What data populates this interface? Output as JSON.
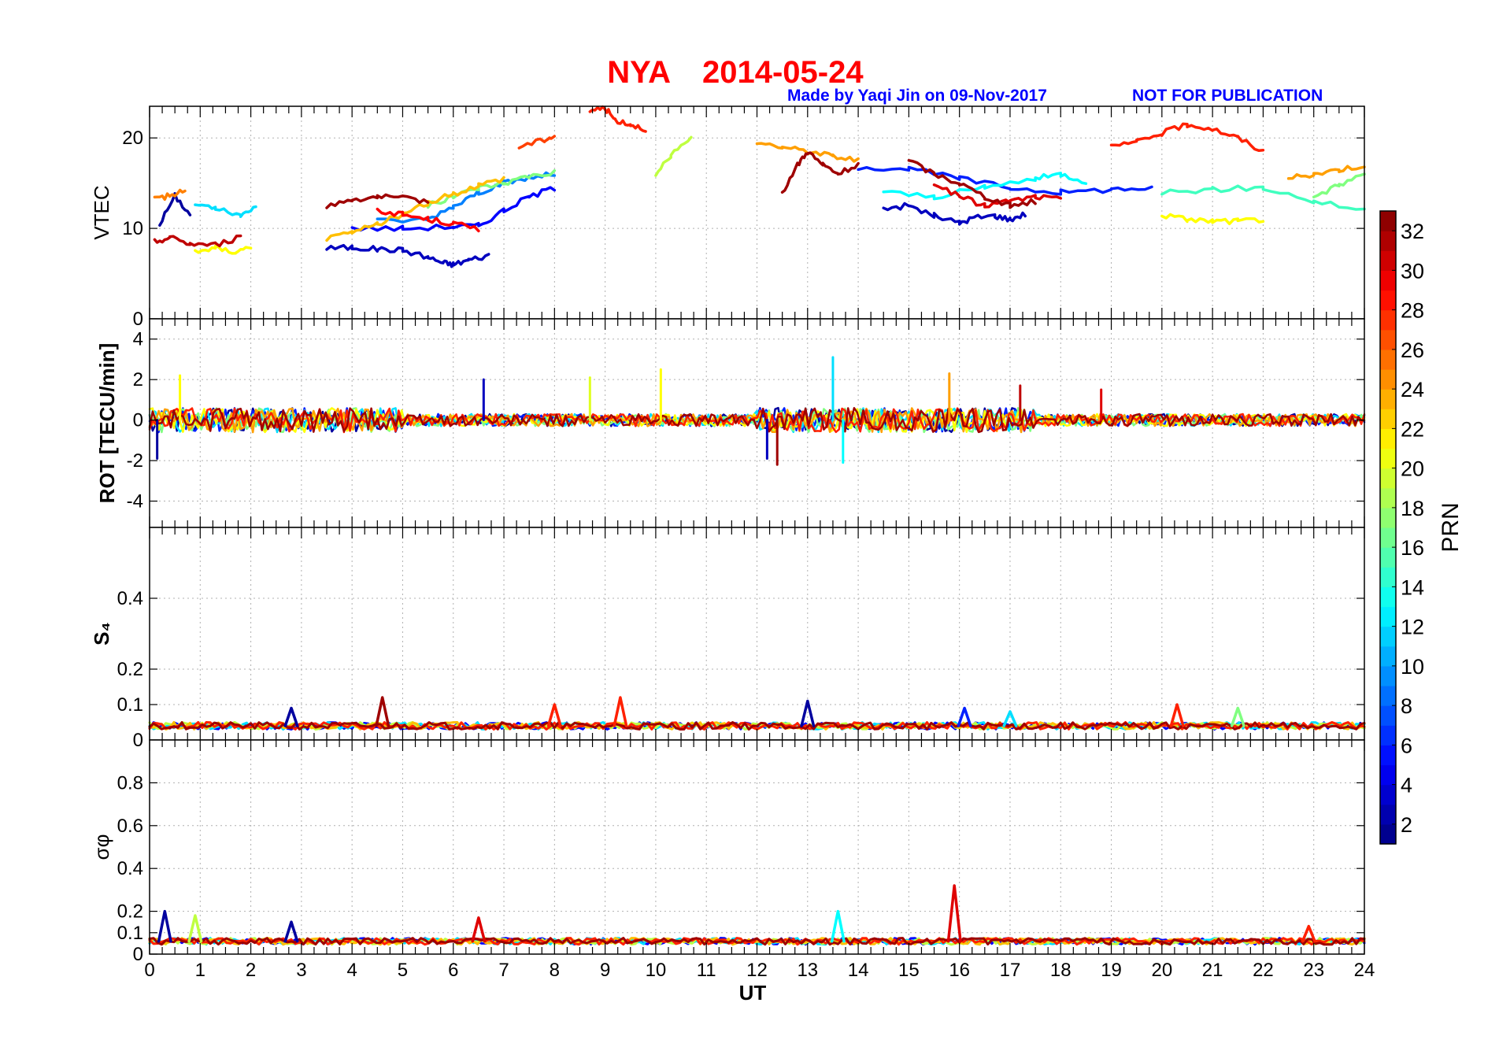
{
  "title": {
    "station": "NYA",
    "date": "2014-05-24",
    "credit": "Made by Yaqi Jin on 09-Nov-2017",
    "notice": "NOT FOR PUBLICATION",
    "title_color": "#ff0000",
    "credit_color": "#0000ff"
  },
  "chart_data": {
    "type": "line",
    "x": {
      "label": "UT",
      "range": [
        0,
        24
      ],
      "ticks": [
        0,
        1,
        2,
        3,
        4,
        5,
        6,
        7,
        8,
        9,
        10,
        11,
        12,
        13,
        14,
        15,
        16,
        17,
        18,
        19,
        20,
        21,
        22,
        23,
        24
      ]
    },
    "grid": true,
    "colormap": "jet",
    "colorbar": {
      "label": "PRN",
      "range": [
        1,
        33
      ],
      "ticks": [
        2,
        4,
        6,
        8,
        10,
        12,
        14,
        16,
        18,
        20,
        22,
        24,
        26,
        28,
        30,
        32
      ],
      "placement": "right"
    },
    "panels": [
      {
        "id": "vtec",
        "ylabel": "VTEC",
        "yrange": [
          0,
          23.5
        ],
        "yticks": [
          0,
          10,
          20
        ],
        "series": [
          {
            "prn": 2,
            "x": [
              0.2,
              0.5,
              0.8
            ],
            "y": [
              10.5,
              13.6,
              11.5
            ]
          },
          {
            "prn": 3,
            "x": [
              3.5,
              4.0,
              4.5,
              5.0,
              5.5,
              5.8,
              6.0,
              6.3,
              6.7
            ],
            "y": [
              7.8,
              7.9,
              7.7,
              7.6,
              6.8,
              6.2,
              6.0,
              6.5,
              7.0
            ]
          },
          {
            "prn": 3,
            "x": [
              14.5,
              15.0,
              15.5,
              16.0,
              16.3,
              16.7,
              17.0,
              17.3
            ],
            "y": [
              12.2,
              12.5,
              11.4,
              10.6,
              11.2,
              11.4,
              11.0,
              11.6
            ]
          },
          {
            "prn": 5,
            "x": [
              4.0,
              5.0,
              6.0,
              6.5,
              7.0,
              7.5,
              8.0
            ],
            "y": [
              10.0,
              10.0,
              10.2,
              10.3,
              12.0,
              13.5,
              14.5
            ]
          },
          {
            "prn": 6,
            "x": [
              14.0,
              15.0,
              16.0,
              17.0,
              18.0,
              19.0,
              19.8
            ],
            "y": [
              16.8,
              16.6,
              15.5,
              14.5,
              14.0,
              14.3,
              14.5
            ]
          },
          {
            "prn": 9,
            "x": [
              4.5,
              5.5,
              6.0,
              6.5,
              7.0,
              7.5,
              8.0
            ],
            "y": [
              10.8,
              11.0,
              12.5,
              14.0,
              15.0,
              15.6,
              16.0
            ]
          },
          {
            "prn": 12,
            "x": [
              0.9,
              1.3,
              1.8,
              2.1
            ],
            "y": [
              12.5,
              12.2,
              11.3,
              12.5
            ]
          },
          {
            "prn": 13,
            "x": [
              14.5,
              15.5,
              16.5,
              17.5,
              18.0,
              18.5
            ],
            "y": [
              14.0,
              13.5,
              14.5,
              15.5,
              16.0,
              15.2
            ]
          },
          {
            "prn": 15,
            "x": [
              20.0,
              21.0,
              22.0,
              23.0,
              24.0
            ],
            "y": [
              14.0,
              14.3,
              14.5,
              13.0,
              12.0
            ]
          },
          {
            "prn": 17,
            "x": [
              5.5,
              6.0,
              6.5,
              7.0,
              7.5,
              8.0
            ],
            "y": [
              12.5,
              13.5,
              14.5,
              15.0,
              15.8,
              16.2
            ]
          },
          {
            "prn": 17,
            "x": [
              23.0,
              23.5,
              24.0
            ],
            "y": [
              13.5,
              14.8,
              16.0
            ]
          },
          {
            "prn": 19,
            "x": [
              10.0,
              10.3,
              10.7
            ],
            "y": [
              16.0,
              18.0,
              20.0
            ]
          },
          {
            "prn": 21,
            "x": [
              0.9,
              1.3,
              1.7,
              2.0
            ],
            "y": [
              7.5,
              7.8,
              7.4,
              8.0
            ]
          },
          {
            "prn": 21,
            "x": [
              20.0,
              20.5,
              21.0,
              21.5,
              22.0
            ],
            "y": [
              11.5,
              11.0,
              10.8,
              10.8,
              11.0
            ]
          },
          {
            "prn": 23,
            "x": [
              3.5,
              4.0,
              4.5,
              5.0,
              5.5,
              6.0,
              6.5,
              7.0
            ],
            "y": [
              8.8,
              9.5,
              10.5,
              11.5,
              12.8,
              13.8,
              14.8,
              15.5
            ]
          },
          {
            "prn": 24,
            "x": [
              12.0,
              12.5,
              13.0,
              13.5,
              14.0
            ],
            "y": [
              19.5,
              19.0,
              18.5,
              18.0,
              17.5
            ]
          },
          {
            "prn": 24,
            "x": [
              22.5,
              23.0,
              23.5,
              24.0
            ],
            "y": [
              15.5,
              16.0,
              16.5,
              17.0
            ]
          },
          {
            "prn": 25,
            "x": [
              0.1,
              0.4,
              0.7
            ],
            "y": [
              13.3,
              13.6,
              14.2
            ]
          },
          {
            "prn": 27,
            "x": [
              7.3,
              7.8,
              8.0
            ],
            "y": [
              19.0,
              19.8,
              20.2
            ]
          },
          {
            "prn": 28,
            "x": [
              8.7,
              9.0,
              9.2,
              9.5,
              9.8
            ],
            "y": [
              23.0,
              23.3,
              22.0,
              21.5,
              21.0
            ]
          },
          {
            "prn": 28,
            "x": [
              19.0,
              19.5,
              20.0,
              20.5,
              21.0,
              21.5,
              22.0
            ],
            "y": [
              19.0,
              19.5,
              20.5,
              21.5,
              21.0,
              20.0,
              18.5
            ]
          },
          {
            "prn": 29,
            "x": [
              4.5,
              5.0,
              5.5,
              6.0,
              6.5
            ],
            "y": [
              12.0,
              11.5,
              11.0,
              10.5,
              10.0
            ]
          },
          {
            "prn": 30,
            "x": [
              15.5,
              16.0,
              16.5,
              17.0,
              17.5,
              18.0
            ],
            "y": [
              15.0,
              13.5,
              12.5,
              13.0,
              13.5,
              13.2
            ]
          },
          {
            "prn": 31,
            "x": [
              0.1,
              0.4,
              0.8,
              1.3,
              1.8
            ],
            "y": [
              8.5,
              9.0,
              8.3,
              8.2,
              9.0
            ]
          },
          {
            "prn": 32,
            "x": [
              3.5,
              4.0,
              4.5,
              5.0,
              5.5
            ],
            "y": [
              12.5,
              13.2,
              13.5,
              13.3,
              13.0
            ]
          },
          {
            "prn": 32,
            "x": [
              12.5,
              12.8,
              13.0,
              13.3,
              13.6,
              14.0
            ],
            "y": [
              14.0,
              17.0,
              18.5,
              17.0,
              16.0,
              17.0
            ]
          },
          {
            "prn": 32,
            "x": [
              15.0,
              15.5,
              16.0,
              16.5,
              17.0,
              17.5
            ],
            "y": [
              17.5,
              16.0,
              15.0,
              13.5,
              12.5,
              13.0
            ]
          }
        ]
      },
      {
        "id": "rot",
        "ylabel": "ROT [TECU/min]",
        "yrange": [
          -5.3,
          5.0
        ],
        "yticks": [
          -4,
          -2,
          0,
          2,
          4
        ],
        "spikes": [
          {
            "prn": 2,
            "x": 0.15,
            "y": -1.9
          },
          {
            "prn": 21,
            "x": 0.6,
            "y": 2.2
          },
          {
            "prn": 3,
            "x": 6.6,
            "y": 2.0
          },
          {
            "prn": 21,
            "x": 10.1,
            "y": 2.5
          },
          {
            "prn": 20,
            "x": 8.7,
            "y": 2.1
          },
          {
            "prn": 3,
            "x": 12.2,
            "y": -1.9
          },
          {
            "prn": 32,
            "x": 12.4,
            "y": -2.2
          },
          {
            "prn": 12,
            "x": 13.5,
            "y": 3.1
          },
          {
            "prn": 13,
            "x": 13.7,
            "y": -2.1
          },
          {
            "prn": 24,
            "x": 15.8,
            "y": 2.3
          },
          {
            "prn": 31,
            "x": 17.2,
            "y": 1.7
          },
          {
            "prn": 30,
            "x": 18.8,
            "y": 1.5
          }
        ]
      },
      {
        "id": "s4",
        "ylabel": "S₄",
        "yrange": [
          0,
          0.6
        ],
        "yticks": [
          0,
          0.1,
          0.2,
          0.4
        ],
        "peaks": [
          {
            "prn": 32,
            "x": 4.6,
            "y": 0.12
          },
          {
            "prn": 28,
            "x": 9.3,
            "y": 0.12
          },
          {
            "prn": 2,
            "x": 2.8,
            "y": 0.09
          },
          {
            "prn": 2,
            "x": 13.0,
            "y": 0.11
          },
          {
            "prn": 28,
            "x": 8.0,
            "y": 0.1
          },
          {
            "prn": 28,
            "x": 20.3,
            "y": 0.1
          },
          {
            "prn": 17,
            "x": 21.5,
            "y": 0.09
          },
          {
            "prn": 6,
            "x": 16.1,
            "y": 0.09
          },
          {
            "prn": 12,
            "x": 17.0,
            "y": 0.08
          }
        ]
      },
      {
        "id": "sigphi",
        "ylabel": "σφ",
        "yrange": [
          0,
          1.0
        ],
        "yticks": [
          0,
          0.1,
          0.2,
          0.4,
          0.6,
          0.8
        ],
        "peaks": [
          {
            "prn": 30,
            "x": 15.9,
            "y": 0.32
          },
          {
            "prn": 2,
            "x": 0.3,
            "y": 0.2
          },
          {
            "prn": 13,
            "x": 13.6,
            "y": 0.2
          },
          {
            "prn": 30,
            "x": 6.5,
            "y": 0.17
          },
          {
            "prn": 2,
            "x": 2.8,
            "y": 0.15
          },
          {
            "prn": 19,
            "x": 0.9,
            "y": 0.18
          },
          {
            "prn": 28,
            "x": 22.9,
            "y": 0.13
          }
        ]
      }
    ]
  }
}
